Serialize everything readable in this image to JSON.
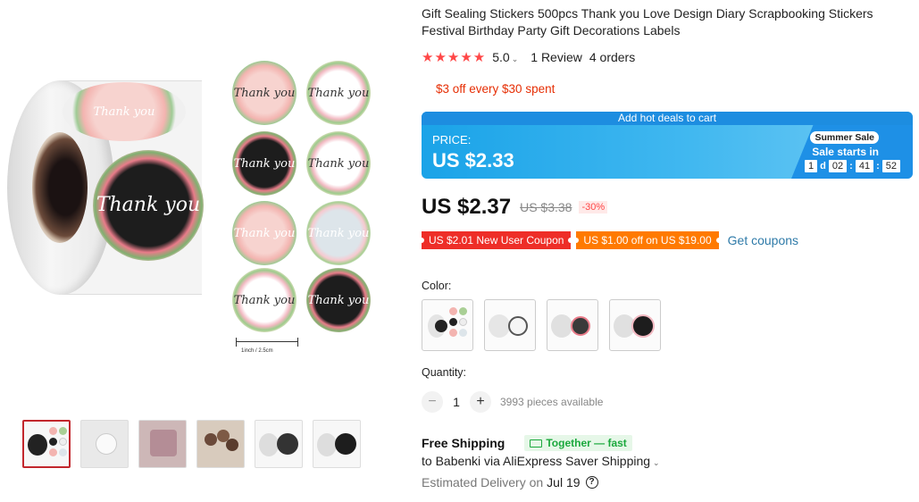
{
  "product": {
    "title": "Gift Sealing Stickers 500pcs Thank you Love Design Diary Scrapbooking Stickers Festival Birthday Party Gift Decorations Labels",
    "rating": "5.0",
    "reviews": "1 Review",
    "orders": "4 orders",
    "store_promo": "$3 off every $30 spent"
  },
  "gallery": {
    "sticker_text": "Thank you",
    "size_label": "1inch / 2.5cm",
    "thumbnail_count": 6
  },
  "deal": {
    "header": "Add hot deals to cart",
    "price_label": "PRICE:",
    "price": "US $2.33",
    "badge": "Summer Sale",
    "sale_starts": "Sale starts in",
    "countdown": {
      "days": "1",
      "day_unit": "d",
      "hours": "02",
      "minutes": "41",
      "seconds": "52"
    }
  },
  "pricing": {
    "current": "US $2.37",
    "original": "US $3.38",
    "discount": "-30%"
  },
  "coupons": [
    {
      "label": "US $2.01 New User Coupon"
    },
    {
      "label": "US $1.00 off on US $19.00"
    }
  ],
  "get_coupons": "Get coupons",
  "color": {
    "label": "Color:",
    "option_count": 4
  },
  "quantity": {
    "label": "Quantity:",
    "minus": "−",
    "value": "1",
    "plus": "+",
    "available": "3993 pieces available"
  },
  "shipping": {
    "title": "Free Shipping",
    "tag": "Together — fast",
    "destination": "to Babenki via AliExpress Saver Shipping",
    "delivery_label": "Estimated Delivery on",
    "delivery_date": "Jul 19"
  },
  "colors": {
    "accent_red": "#ff4747",
    "banner_blue": "#1aa3e8",
    "green": "#1ca93e",
    "link": "#2e7aa8"
  }
}
